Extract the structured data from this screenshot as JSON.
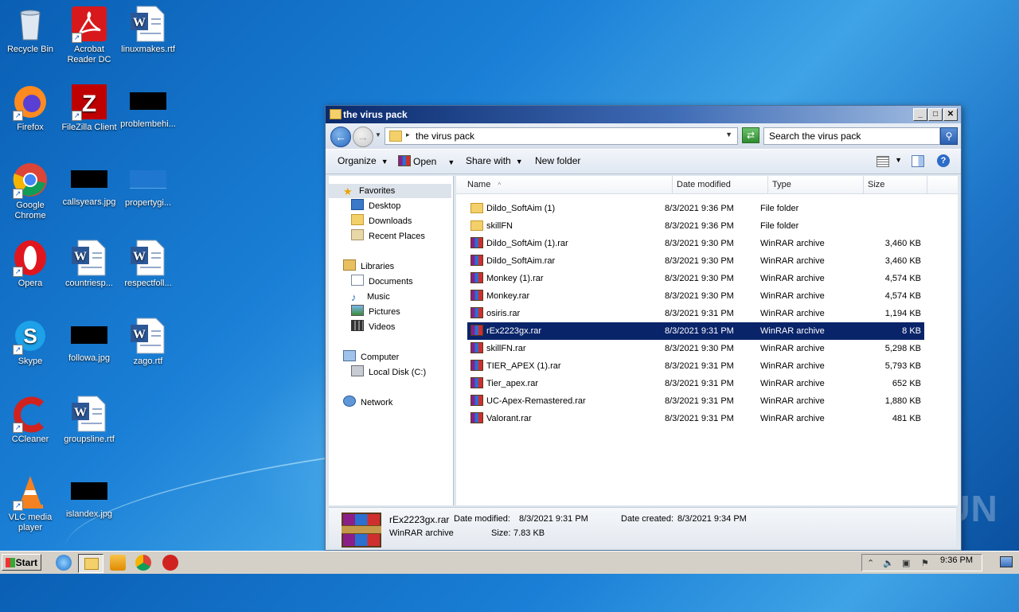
{
  "desktop": {
    "icons": [
      {
        "label": "Recycle Bin"
      },
      {
        "label": "Acrobat Reader DC"
      },
      {
        "label": "linuxmakes.rtf"
      },
      {
        "label": "Firefox"
      },
      {
        "label": "FileZilla Client"
      },
      {
        "label": "problembehi..."
      },
      {
        "label": "Google Chrome"
      },
      {
        "label": "callsyears.jpg"
      },
      {
        "label": "propertygi..."
      },
      {
        "label": "Opera"
      },
      {
        "label": "countriesp..."
      },
      {
        "label": "respectfoll..."
      },
      {
        "label": "Skype"
      },
      {
        "label": "followa.jpg"
      },
      {
        "label": "zago.rtf"
      },
      {
        "label": "CCleaner"
      },
      {
        "label": "groupsline.rtf"
      },
      {
        "label": "VLC media player"
      },
      {
        "label": "islandex.jpg"
      }
    ]
  },
  "window": {
    "title": "the virus pack",
    "address": "the virus pack",
    "search_placeholder": "Search the virus pack",
    "toolbar": {
      "organize": "Organize",
      "open": "Open",
      "share_with": "Share with",
      "new_folder": "New folder"
    },
    "nav": {
      "favorites": "Favorites",
      "desktop": "Desktop",
      "downloads": "Downloads",
      "recent_places": "Recent Places",
      "libraries": "Libraries",
      "documents": "Documents",
      "music": "Music",
      "pictures": "Pictures",
      "videos": "Videos",
      "computer": "Computer",
      "local_disk": "Local Disk (C:)",
      "network": "Network"
    },
    "columns": {
      "name": "Name",
      "date": "Date modified",
      "type": "Type",
      "size": "Size"
    },
    "files": [
      {
        "name": "Dildo_SoftAim (1)",
        "date": "8/3/2021 9:36 PM",
        "type": "File folder",
        "size": ""
      },
      {
        "name": "skillFN",
        "date": "8/3/2021 9:36 PM",
        "type": "File folder",
        "size": ""
      },
      {
        "name": "Dildo_SoftAim (1).rar",
        "date": "8/3/2021 9:30 PM",
        "type": "WinRAR archive",
        "size": "3,460 KB"
      },
      {
        "name": "Dildo_SoftAim.rar",
        "date": "8/3/2021 9:30 PM",
        "type": "WinRAR archive",
        "size": "3,460 KB"
      },
      {
        "name": "Monkey (1).rar",
        "date": "8/3/2021 9:30 PM",
        "type": "WinRAR archive",
        "size": "4,574 KB"
      },
      {
        "name": "Monkey.rar",
        "date": "8/3/2021 9:30 PM",
        "type": "WinRAR archive",
        "size": "4,574 KB"
      },
      {
        "name": "osiris.rar",
        "date": "8/3/2021 9:31 PM",
        "type": "WinRAR archive",
        "size": "1,194 KB"
      },
      {
        "name": "rEx2223gx.rar",
        "date": "8/3/2021 9:31 PM",
        "type": "WinRAR archive",
        "size": "8 KB"
      },
      {
        "name": "skillFN.rar",
        "date": "8/3/2021 9:30 PM",
        "type": "WinRAR archive",
        "size": "5,298 KB"
      },
      {
        "name": "TIER_APEX (1).rar",
        "date": "8/3/2021 9:31 PM",
        "type": "WinRAR archive",
        "size": "5,793 KB"
      },
      {
        "name": "Tier_apex.rar",
        "date": "8/3/2021 9:31 PM",
        "type": "WinRAR archive",
        "size": "652 KB"
      },
      {
        "name": "UC-Apex-Remastered.rar",
        "date": "8/3/2021 9:31 PM",
        "type": "WinRAR archive",
        "size": "1,880 KB"
      },
      {
        "name": "Valorant.rar",
        "date": "8/3/2021 9:31 PM",
        "type": "WinRAR archive",
        "size": "481 KB"
      }
    ],
    "selected_index": 7,
    "details": {
      "name": "rEx2223gx.rar",
      "type": "WinRAR archive",
      "modified_label": "Date modified:",
      "modified": "8/3/2021 9:31 PM",
      "created_label": "Date created:",
      "created": "8/3/2021 9:34 PM",
      "size_label": "Size:",
      "size": "7.83 KB"
    }
  },
  "taskbar": {
    "start": "Start",
    "clock": "9:36 PM"
  },
  "watermark": "ANY RUN"
}
